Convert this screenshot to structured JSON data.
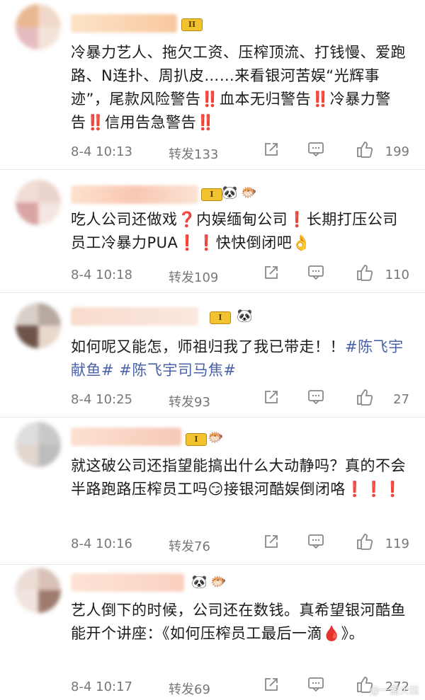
{
  "comments": [
    {
      "badge": "II",
      "emoji": [],
      "segments": [
        {
          "t": "冷暴力艺人、拖欠工资、压榨顶流、打钱慢、爱跑路、N连扑、周扒皮……来看银河苦娱“光辉事迹”，尾款风险警告",
          "tag": false
        },
        {
          "t": "‼️",
          "tag": false
        },
        {
          "t": "血本无归警告",
          "tag": false
        },
        {
          "t": "‼️",
          "tag": false
        },
        {
          "t": "冷暴力警告",
          "tag": false
        },
        {
          "t": "‼️",
          "tag": false
        },
        {
          "t": "信用告急警告",
          "tag": false
        },
        {
          "t": "‼️",
          "tag": false
        }
      ],
      "time": "8-4 10:13",
      "repost": "转发133",
      "likes": "199"
    },
    {
      "badge": "I",
      "emoji": [
        "🐼",
        "🐡"
      ],
      "segments": [
        {
          "t": "吃人公司还做戏",
          "tag": false
        },
        {
          "t": "❓",
          "tag": false
        },
        {
          "t": "内娱缅甸公司",
          "tag": false
        },
        {
          "t": "❗",
          "tag": false
        },
        {
          "t": "长期打压公司员工冷暴力PUA",
          "tag": false
        },
        {
          "t": "❗❗",
          "tag": false
        },
        {
          "t": "快快倒闭吧",
          "tag": false
        },
        {
          "t": "👌",
          "tag": false
        }
      ],
      "time": "8-4 10:18",
      "repost": "转发109",
      "likes": "110"
    },
    {
      "badge": "I",
      "emoji": [
        "🐼"
      ],
      "segments": [
        {
          "t": "如何呢又能怎，师祖归我了我已带走！！",
          "tag": false
        },
        {
          "t": "#陈飞宇献鱼#",
          "tag": true
        },
        {
          "t": " ",
          "tag": false
        },
        {
          "t": "#陈飞宇司马焦#",
          "tag": true
        }
      ],
      "time": "8-4 10:25",
      "repost": "转发93",
      "likes": "27"
    },
    {
      "badge": "I",
      "emoji": [
        "🐡"
      ],
      "segments": [
        {
          "t": "就这破公司还指望能搞出什么大动静吗？真的不会半路跑路压榨员工吗",
          "tag": false
        },
        {
          "t": "😏",
          "tag": false
        },
        {
          "t": "接银河酷娱倒闭咯",
          "tag": false
        },
        {
          "t": "❗❗❗",
          "tag": false
        }
      ],
      "time": "8-4 10:16",
      "repost": "转发76",
      "likes": "119"
    },
    {
      "badge": "",
      "emoji": [
        "🐼",
        "🐡"
      ],
      "segments": [
        {
          "t": "艺人倒下的时候，公司还在数钱。真希望银河酷鱼能开个讲座：《如何压榨员工最后一滴",
          "tag": false
        },
        {
          "t": "🩸",
          "tag": false
        },
        {
          "t": "》。",
          "tag": false
        }
      ],
      "time": "8-4 10:17",
      "repost": "转发69",
      "likes": "272"
    }
  ],
  "watermark": "@一盏火拉",
  "colors": {
    "topic": "#4a63a8",
    "meta": "#777777",
    "badge": "#f2c32e",
    "divider": "#e8e8e8"
  },
  "icons": {
    "share": "share-square-icon",
    "reply": "comment-bubble-icon",
    "like": "thumbs-up-icon"
  }
}
